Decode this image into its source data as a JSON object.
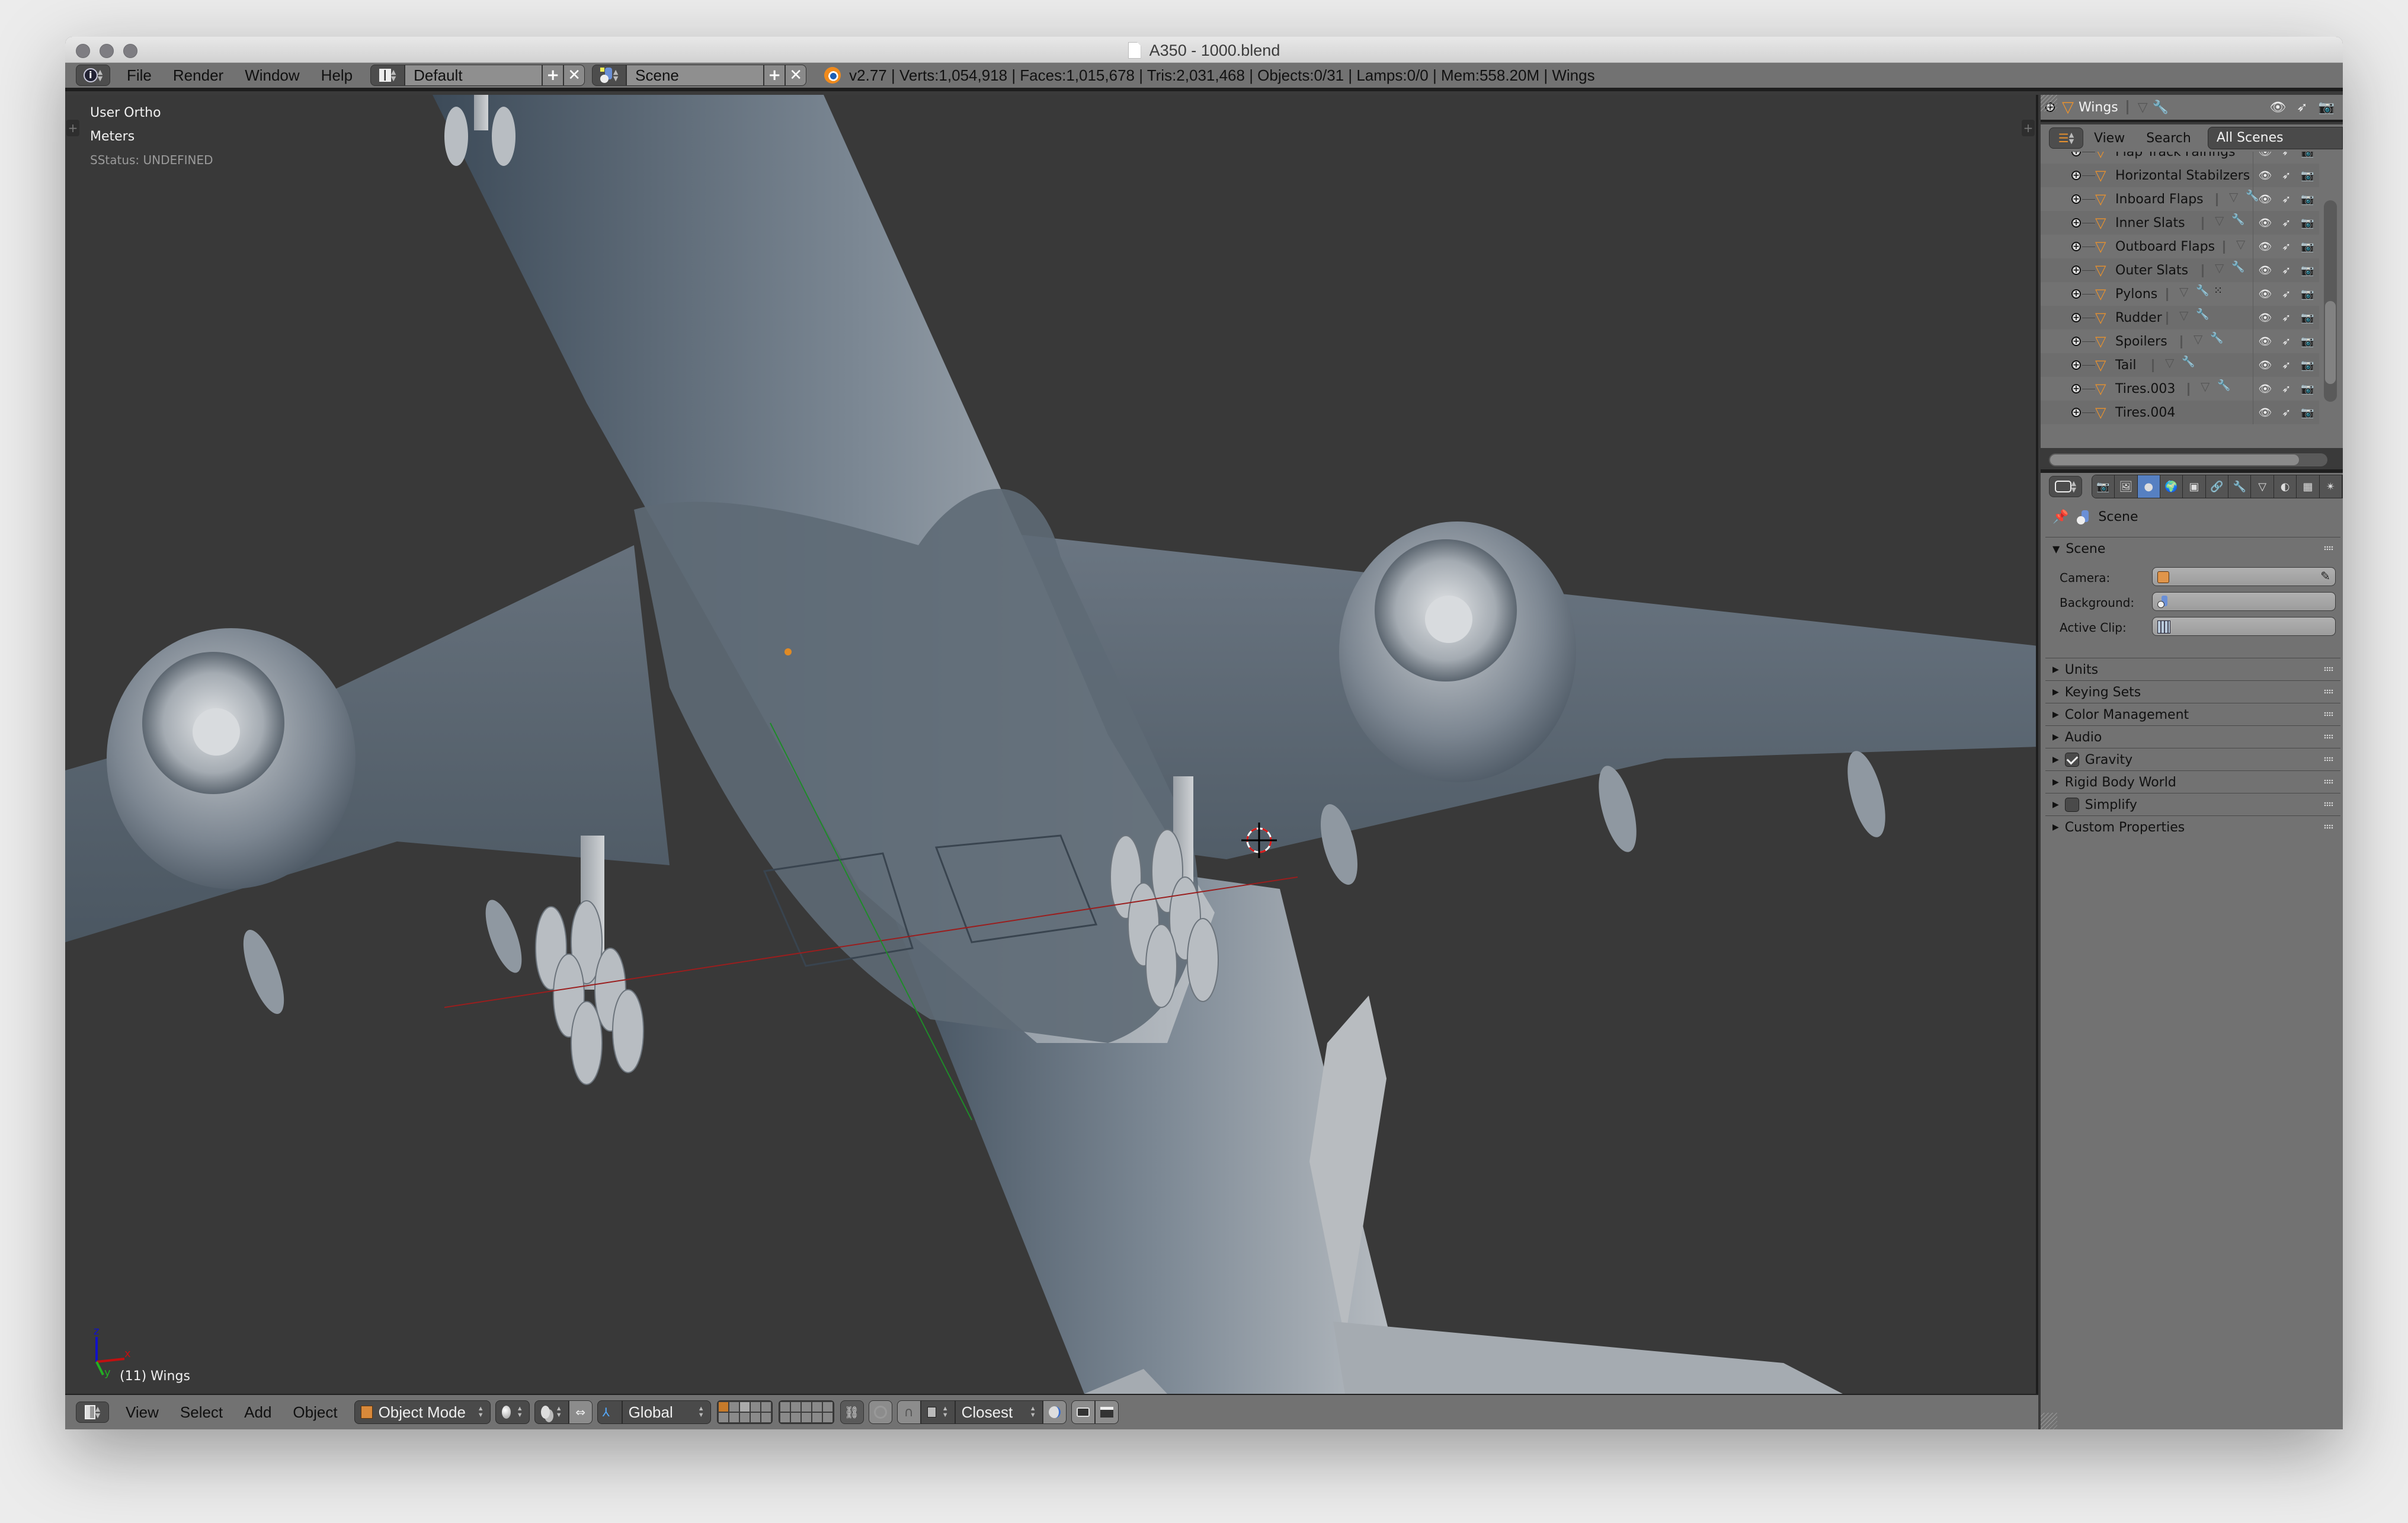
{
  "window": {
    "title": "A350 - 1000.blend"
  },
  "info_header": {
    "menus": [
      "File",
      "Render",
      "Window",
      "Help"
    ],
    "screen_layout": "Default",
    "scene": "Scene",
    "stats": "v2.77 | Verts:1,054,918 | Faces:1,015,678 | Tris:2,031,468 | Objects:0/31 | Lamps:0/0 | Mem:558.20M | Wings"
  },
  "viewport": {
    "view_name": "User Ortho",
    "units": "Meters",
    "status": "SStatus: UNDEFINED",
    "active_object_label": "(11) Wings",
    "axes": {
      "x": "x",
      "y": "y",
      "z": "z"
    },
    "colors": {
      "background": "#393939",
      "x_axis": "#c01010",
      "y_axis": "#22b022",
      "z_axis": "#1010c8",
      "model": "#8a949e"
    }
  },
  "view3d_header": {
    "menus": [
      "View",
      "Select",
      "Add",
      "Object"
    ],
    "mode": "Object Mode",
    "transform_orientation": "Global",
    "snap_target": "Closest"
  },
  "outliner": {
    "active_object": "Wings",
    "menus": [
      "View",
      "Search"
    ],
    "display_mode": "All Scenes",
    "items": [
      {
        "name": "Flap Track Fairings",
        "partial": true
      },
      {
        "name": "Horizontal Stabilzers",
        "mesh": false,
        "modifier": false
      },
      {
        "name": "Inboard Flaps",
        "mesh": true,
        "modifier": true
      },
      {
        "name": "Inner Slats",
        "mesh": true,
        "modifier": true
      },
      {
        "name": "Outboard Flaps",
        "mesh": true,
        "modifier": false
      },
      {
        "name": "Outer Slats",
        "mesh": true,
        "modifier": true
      },
      {
        "name": "Pylons",
        "mesh": true,
        "modifier": true,
        "vertex_group": true
      },
      {
        "name": "Rudder",
        "mesh": true,
        "modifier": true
      },
      {
        "name": "Spoilers",
        "mesh": true,
        "modifier": true
      },
      {
        "name": "Tail",
        "mesh": true,
        "modifier": true
      },
      {
        "name": "Tires.003",
        "mesh": true,
        "modifier": true
      },
      {
        "name": "Tires.004",
        "partial": true
      }
    ]
  },
  "properties": {
    "tabs": [
      "render",
      "render-layers",
      "scene",
      "world",
      "object",
      "constraints",
      "modifiers",
      "data",
      "material",
      "texture",
      "particles"
    ],
    "active_tab": "scene",
    "context": "Scene",
    "scene_panel": {
      "title": "Scene",
      "fields": [
        {
          "label": "Camera:",
          "value": ""
        },
        {
          "label": "Background:",
          "value": ""
        },
        {
          "label": "Active Clip:",
          "value": ""
        }
      ]
    },
    "panels": [
      {
        "title": "Units",
        "checkbox": null
      },
      {
        "title": "Keying Sets",
        "checkbox": null
      },
      {
        "title": "Color Management",
        "checkbox": null
      },
      {
        "title": "Audio",
        "checkbox": null
      },
      {
        "title": "Gravity",
        "checkbox": true
      },
      {
        "title": "Rigid Body World",
        "checkbox": null
      },
      {
        "title": "Simplify",
        "checkbox": false
      },
      {
        "title": "Custom Properties",
        "checkbox": null
      }
    ]
  }
}
